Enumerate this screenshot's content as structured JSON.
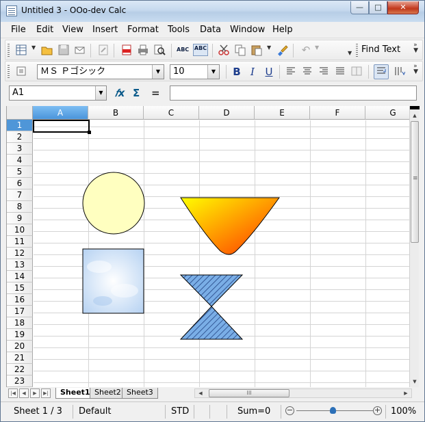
{
  "window": {
    "title": "Untitled 3 - OOo-dev Calc",
    "controls": {
      "minimize": "—",
      "maximize": "□",
      "close": "✕"
    }
  },
  "menu": [
    "File",
    "Edit",
    "View",
    "Insert",
    "Format",
    "Tools",
    "Data",
    "Window",
    "Help"
  ],
  "standard_toolbar": {
    "icons": [
      "new-document-icon",
      "open-folder-icon",
      "save-icon",
      "email-icon",
      "edit-file-icon",
      "export-pdf-icon",
      "print-icon",
      "page-preview-icon",
      "spellcheck-icon",
      "autospellcheck-icon",
      "cut-icon",
      "copy-icon",
      "paste-icon",
      "format-paintbrush-icon",
      "undo-icon"
    ],
    "find_text": "Find Text"
  },
  "formatting_toolbar": {
    "font_name": "ＭＳ Ｐゴシック",
    "font_size": "10",
    "buttons": {
      "bold": "B",
      "italic": "I",
      "underline": "U"
    }
  },
  "formula_bar": {
    "cell_reference": "A1",
    "formula": "",
    "fx": "𝑓x",
    "sum": "Σ",
    "equals": "="
  },
  "grid": {
    "columns": [
      "A",
      "B",
      "C",
      "D",
      "E",
      "F",
      "G"
    ],
    "selected_column": "A",
    "rows": [
      "1",
      "2",
      "3",
      "4",
      "5",
      "6",
      "7",
      "8",
      "9",
      "10",
      "11",
      "12",
      "13",
      "14",
      "15",
      "16",
      "17",
      "18",
      "19",
      "20",
      "21",
      "22",
      "23"
    ],
    "selected_row": "1",
    "active_cell": "A1"
  },
  "shapes": {
    "circle": {
      "fill": "#ffffc0",
      "stroke": "#000000"
    },
    "square": {
      "fill": "#c6dcf4",
      "stroke": "#000000"
    },
    "funnel": {
      "gradient_start": "#ffff00",
      "gradient_end": "#ff3300",
      "stroke": "#000000"
    },
    "hourglass": {
      "fill": "#7aaee6",
      "hatch": "#1c3c7c",
      "stroke": "#000000"
    }
  },
  "sheet_tabs": [
    "Sheet1",
    "Sheet2",
    "Sheet3"
  ],
  "active_sheet": "Sheet1",
  "hscroll_thumb": "III",
  "statusbar": {
    "sheet": "Sheet 1 / 3",
    "page_style": "Default",
    "selection_mode": "STD",
    "sum": "Sum=0",
    "zoom": "100%",
    "zoom_minus": "−",
    "zoom_plus": "+"
  }
}
